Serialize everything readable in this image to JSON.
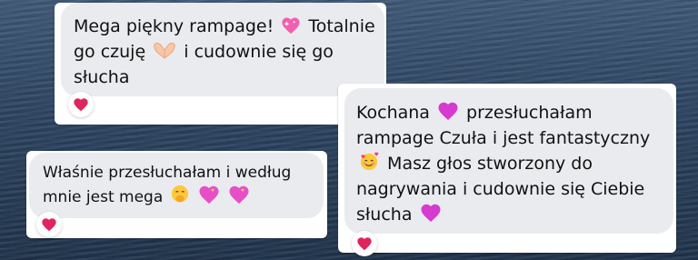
{
  "messages": [
    {
      "id": "msg1",
      "lines": [
        "Mega piękny rampage!",
        " Totalnie",
        "go czuję",
        " i cudownie się go",
        "słucha"
      ],
      "reaction": "red-heart"
    },
    {
      "id": "msg2",
      "lines": [
        "Kochana ",
        " przesłuchałam",
        "rampage Czuła i jest fantastyczny",
        " Masz głos stworzony do",
        "nagrywania i cudownie się Ciebie",
        "słucha "
      ],
      "reaction": "red-heart"
    },
    {
      "id": "msg3",
      "lines": [
        "Właśnie przesłuchałam i według",
        "mnie jest mega "
      ],
      "reaction": "red-heart"
    }
  ],
  "colors": {
    "bubble": "#e9ebef",
    "heart_red": "#e0245e",
    "pink_heart": "#f46fb5"
  },
  "icons": [
    "pink-sparkle-heart",
    "heart-hands",
    "smiling-face-with-hearts",
    "hand-over-mouth-face",
    "red-heart"
  ]
}
